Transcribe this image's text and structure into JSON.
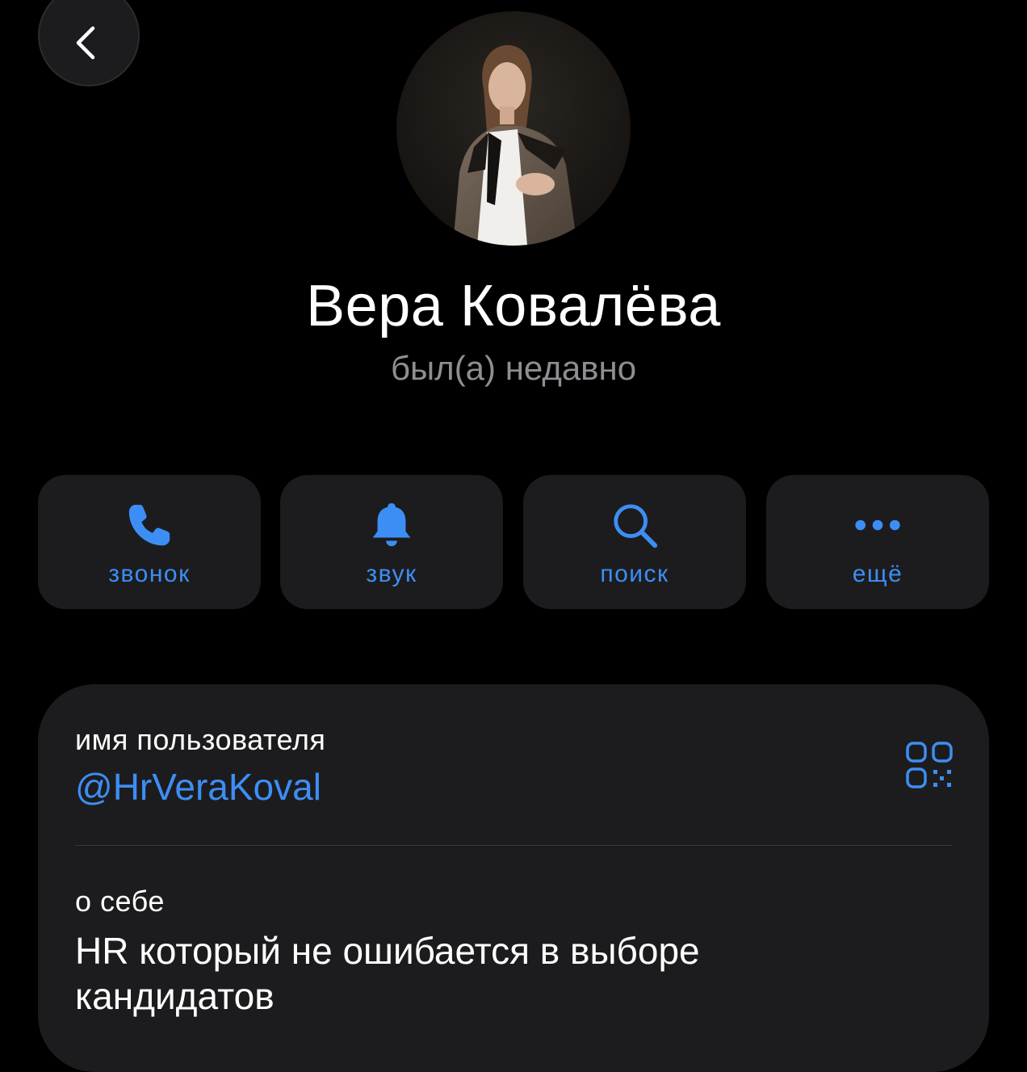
{
  "header": {
    "back_icon": "chevron-left-icon"
  },
  "profile": {
    "avatar_description_icon": "profile-photo",
    "name": "Вера Ковалёва",
    "status": "был(а) недавно"
  },
  "actions": [
    {
      "id": "call",
      "icon": "phone-icon",
      "label": "звонок"
    },
    {
      "id": "sound",
      "icon": "bell-icon",
      "label": "звук"
    },
    {
      "id": "search",
      "icon": "search-icon",
      "label": "поиск"
    },
    {
      "id": "more",
      "icon": "ellipsis-icon",
      "label": "ещё"
    }
  ],
  "info": {
    "username_caption": "имя пользователя",
    "username": "@HrVeraKoval",
    "qr_icon": "qr-code-icon",
    "bio_caption": "о себе",
    "bio": "HR который не ошибается в выборе кандидатов"
  },
  "colors": {
    "background": "#000000",
    "card": "#1c1c1e",
    "accent": "#3d8ef4",
    "secondary_text": "#8e8e93"
  }
}
